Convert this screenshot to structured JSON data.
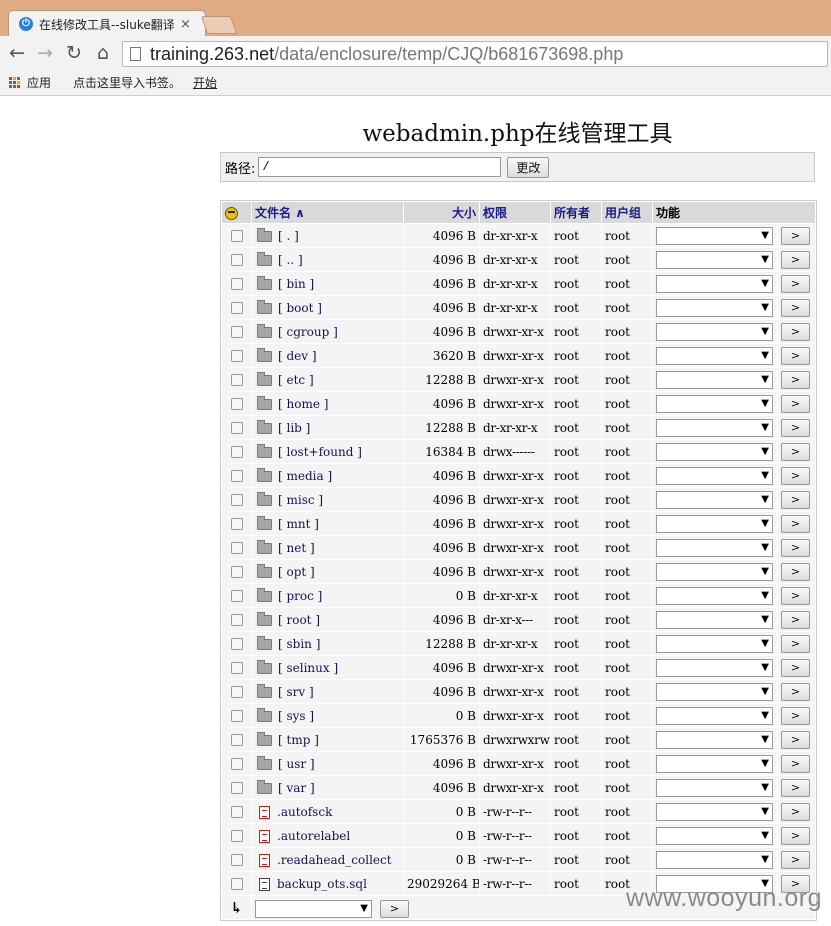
{
  "browser": {
    "tab_title": "在线修改工具--sluke翻译",
    "tab_close": "×",
    "url_host": "training.263.net",
    "url_path": "/data/enclosure/temp/CJQ/b681673698.php",
    "bookmarks": [
      "应用",
      "点击这里导入书签。",
      "开始"
    ]
  },
  "page": {
    "title": "webadmin.php在线管理工具",
    "path_label": "路径:",
    "path_value": "/",
    "path_button": "更改"
  },
  "table": {
    "headers": {
      "name": "文件名 ∧",
      "size": "大小",
      "perm": "权限",
      "owner": "所有者",
      "group": "用户组",
      "action": "功能"
    },
    "go_label": ">",
    "rows": [
      {
        "type": "dir",
        "name": "[ . ]",
        "size": "4096 B",
        "perm": "dr-xr-xr-x",
        "owner": "root",
        "group": "root"
      },
      {
        "type": "dir",
        "name": "[ .. ]",
        "size": "4096 B",
        "perm": "dr-xr-xr-x",
        "owner": "root",
        "group": "root"
      },
      {
        "type": "dir",
        "name": "[ bin ]",
        "size": "4096 B",
        "perm": "dr-xr-xr-x",
        "owner": "root",
        "group": "root"
      },
      {
        "type": "dir",
        "name": "[ boot ]",
        "size": "4096 B",
        "perm": "dr-xr-xr-x",
        "owner": "root",
        "group": "root"
      },
      {
        "type": "dir",
        "name": "[ cgroup ]",
        "size": "4096 B",
        "perm": "drwxr-xr-x",
        "owner": "root",
        "group": "root"
      },
      {
        "type": "dir",
        "name": "[ dev ]",
        "size": "3620 B",
        "perm": "drwxr-xr-x",
        "owner": "root",
        "group": "root"
      },
      {
        "type": "dir",
        "name": "[ etc ]",
        "size": "12288 B",
        "perm": "drwxr-xr-x",
        "owner": "root",
        "group": "root"
      },
      {
        "type": "dir",
        "name": "[ home ]",
        "size": "4096 B",
        "perm": "drwxr-xr-x",
        "owner": "root",
        "group": "root"
      },
      {
        "type": "dir",
        "name": "[ lib ]",
        "size": "12288 B",
        "perm": "dr-xr-xr-x",
        "owner": "root",
        "group": "root"
      },
      {
        "type": "dir",
        "name": "[ lost+found ]",
        "size": "16384 B",
        "perm": "drwx------",
        "owner": "root",
        "group": "root"
      },
      {
        "type": "dir",
        "name": "[ media ]",
        "size": "4096 B",
        "perm": "drwxr-xr-x",
        "owner": "root",
        "group": "root"
      },
      {
        "type": "dir",
        "name": "[ misc ]",
        "size": "4096 B",
        "perm": "drwxr-xr-x",
        "owner": "root",
        "group": "root"
      },
      {
        "type": "dir",
        "name": "[ mnt ]",
        "size": "4096 B",
        "perm": "drwxr-xr-x",
        "owner": "root",
        "group": "root"
      },
      {
        "type": "dir",
        "name": "[ net ]",
        "size": "4096 B",
        "perm": "drwxr-xr-x",
        "owner": "root",
        "group": "root"
      },
      {
        "type": "dir",
        "name": "[ opt ]",
        "size": "4096 B",
        "perm": "drwxr-xr-x",
        "owner": "root",
        "group": "root"
      },
      {
        "type": "dir",
        "name": "[ proc ]",
        "size": "0 B",
        "perm": "dr-xr-xr-x",
        "owner": "root",
        "group": "root"
      },
      {
        "type": "dir",
        "name": "[ root ]",
        "size": "4096 B",
        "perm": "dr-xr-x---",
        "owner": "root",
        "group": "root"
      },
      {
        "type": "dir",
        "name": "[ sbin ]",
        "size": "12288 B",
        "perm": "dr-xr-xr-x",
        "owner": "root",
        "group": "root"
      },
      {
        "type": "dir",
        "name": "[ selinux ]",
        "size": "4096 B",
        "perm": "drwxr-xr-x",
        "owner": "root",
        "group": "root"
      },
      {
        "type": "dir",
        "name": "[ srv ]",
        "size": "4096 B",
        "perm": "drwxr-xr-x",
        "owner": "root",
        "group": "root"
      },
      {
        "type": "dir",
        "name": "[ sys ]",
        "size": "0 B",
        "perm": "drwxr-xr-x",
        "owner": "root",
        "group": "root"
      },
      {
        "type": "dir",
        "name": "[ tmp ]",
        "size": "1765376 B",
        "perm": "drwxrwxrwt",
        "owner": "root",
        "group": "root"
      },
      {
        "type": "dir",
        "name": "[ usr ]",
        "size": "4096 B",
        "perm": "drwxr-xr-x",
        "owner": "root",
        "group": "root"
      },
      {
        "type": "dir",
        "name": "[ var ]",
        "size": "4096 B",
        "perm": "drwxr-xr-x",
        "owner": "root",
        "group": "root"
      },
      {
        "type": "file",
        "name": ".autofsck",
        "size": "0 B",
        "perm": "-rw-r--r--",
        "owner": "root",
        "group": "root"
      },
      {
        "type": "file",
        "name": ".autorelabel",
        "size": "0 B",
        "perm": "-rw-r--r--",
        "owner": "root",
        "group": "root"
      },
      {
        "type": "file",
        "name": ".readahead_collect",
        "size": "0 B",
        "perm": "-rw-r--r--",
        "owner": "root",
        "group": "root"
      },
      {
        "type": "text",
        "name": "backup_ots.sql",
        "size": "29029264 B",
        "perm": "-rw-r--r--",
        "owner": "root",
        "group": "root"
      }
    ]
  },
  "watermark": "www.wooyun.org",
  "colors": {
    "titlebar": "#e0aa82",
    "header_bg": "#d9d9d9",
    "cell_bg": "#f4f4f4",
    "link": "#1a1a8c"
  }
}
